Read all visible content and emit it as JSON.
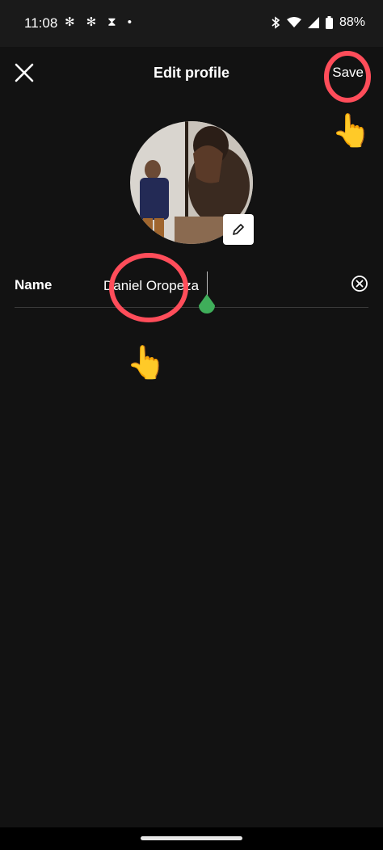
{
  "status_bar": {
    "time": "11:08",
    "left_icons": [
      "slack-icon",
      "slack-icon",
      "hourglass-icon",
      "dot-icon"
    ],
    "battery": "88%"
  },
  "header": {
    "title": "Edit profile",
    "save_label": "Save"
  },
  "profile": {
    "photo": "profile-photo"
  },
  "form": {
    "name_label": "Name",
    "name_value": "Daniel Oropeza"
  },
  "colors": {
    "background": "#121212",
    "annotation_red": "#ff4d5a",
    "caret_green": "#3fae5a"
  }
}
